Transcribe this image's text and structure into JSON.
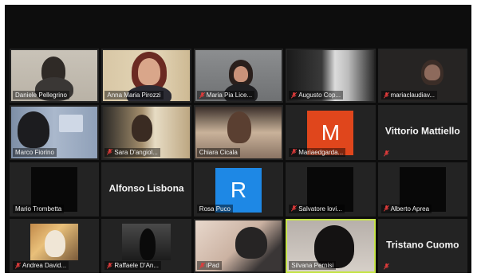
{
  "participants": [
    {
      "name": "Daniele Pellegrino",
      "muted": false
    },
    {
      "name": "Anna Maria Pirozzi",
      "muted": false
    },
    {
      "name": "Maria Pia Lice...",
      "muted": true
    },
    {
      "name": "Augusto Cop...",
      "muted": true
    },
    {
      "name": "mariaclaudiav...",
      "muted": true
    },
    {
      "name": "Marco Fiorino",
      "muted": false
    },
    {
      "name": "Sara D'angiol...",
      "muted": true
    },
    {
      "name": "Chiara Cicala",
      "muted": false
    },
    {
      "name": "Mariaedgarda...",
      "muted": true
    },
    {
      "name": "Vittorio Mattiello",
      "muted": true
    },
    {
      "name": "Mario Trombetta",
      "muted": false
    },
    {
      "name": "Alfonso Lisbona",
      "muted": false
    },
    {
      "name": "Rosa Puco",
      "muted": false,
      "initial": "R",
      "avatar_color": "#1e88e5"
    },
    {
      "name": "Salvatore lovi...",
      "muted": true
    },
    {
      "name": "Alberto Aprea",
      "muted": true
    },
    {
      "name": "Andrea David...",
      "muted": true
    },
    {
      "name": "Raffaele D'An...",
      "muted": true
    },
    {
      "name": "iPad",
      "muted": true
    },
    {
      "name": "Silvana Pernisi",
      "muted": false,
      "speaking": true
    },
    {
      "name": "Tristano Cuomo",
      "muted": true
    }
  ],
  "mariaedgarda": {
    "initial": "M",
    "avatar_color": "#e0461c"
  },
  "colors": {
    "background": "#0d0d0d",
    "tile": "#232323",
    "speaking_border": "#c6e44a",
    "mic_muted": "#e23b3b"
  }
}
